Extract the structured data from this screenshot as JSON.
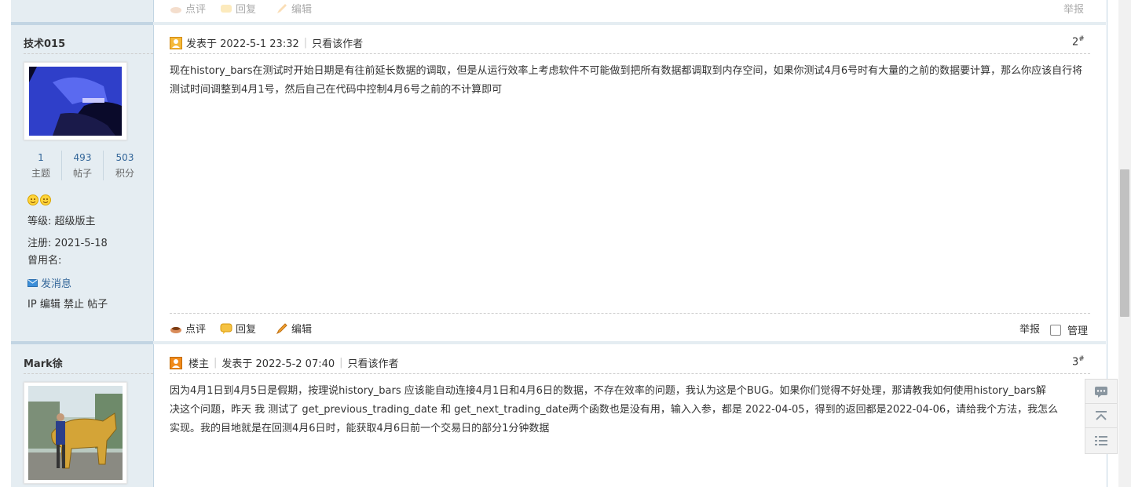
{
  "prev_post_actions": {
    "rate": "点评",
    "reply": "回复",
    "edit": "编辑",
    "report": "举报"
  },
  "posts": [
    {
      "username": "技术015",
      "stats": [
        {
          "value": "1",
          "label": "主题"
        },
        {
          "value": "493",
          "label": "帖子"
        },
        {
          "value": "503",
          "label": "积分"
        }
      ],
      "level": "等级: 超级版主",
      "register": "注册: 2021-5-18",
      "alias": "曾用名:",
      "message_link": "发消息",
      "admin_links": [
        "IP",
        "编辑",
        "禁止",
        "帖子"
      ],
      "posted_at": "发表于 2022-5-1 23:32",
      "only_author": "只看该作者",
      "floor": "2",
      "floor_mark": "#",
      "content": "现在history_bars在测试时开始日期是有往前延长数据的调取，但是从运行效率上考虑软件不可能做到把所有数据都调取到内存空间，如果你测试4月6号时有大量的之前的数据要计算，那么你应该自行将测试时间调整到4月1号，然后自己在代码中控制4月6号之前的不计算即可",
      "actions": {
        "rate": "点评",
        "reply": "回复",
        "edit": "编辑",
        "report": "举报",
        "manage": "管理"
      }
    },
    {
      "username": "Mark徐",
      "owner_badge": "楼主",
      "posted_at": "发表于 2022-5-2 07:40",
      "only_author": "只看该作者",
      "floor": "3",
      "floor_mark": "#",
      "content_lines": [
        "因为4月1日到4月5日是假期，按理说history_bars 应该能自动连接4月1日和4月6日的数据，不存在效率的问题，我认为这是个BUG。如果你们觉得不好处理，那请教我如何使用history_bars解",
        "决这个问题，昨天 我 测试了 get_previous_trading_date  和 get_next_trading_date两个函数也是没有用，输入入参，都是 2022-04-05，得到的返回都是2022-04-06，请给我个方法，我怎么",
        "实现。我的目地就是在回测4月6日时，能获取4月6日前一个交易日的部分1分钟数据"
      ]
    }
  ],
  "colors": {
    "link": "#336699",
    "border": "#c2d5e3",
    "sidebar_bg": "#e5edf2"
  }
}
